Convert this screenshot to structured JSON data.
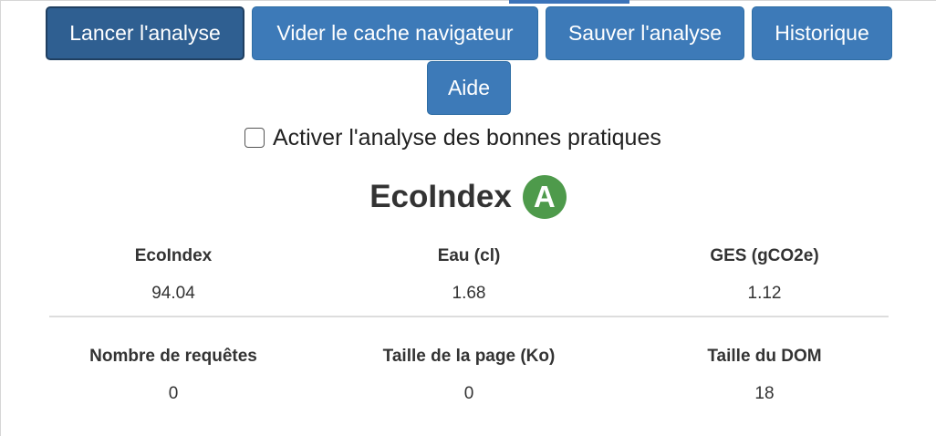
{
  "toolbar": {
    "run_label": "Lancer l'analyse",
    "clear_cache_label": "Vider le cache navigateur",
    "save_label": "Sauver l'analyse",
    "history_label": "Historique",
    "help_label": "Aide"
  },
  "options": {
    "best_practices_checkbox_label": "Activer l'analyse des bonnes pratiques",
    "best_practices_checked": false
  },
  "ecoindex": {
    "title": "EcoIndex",
    "grade": "A",
    "grade_color": "#4e9a4b"
  },
  "metrics": {
    "row1": [
      {
        "label": "EcoIndex",
        "value": "94.04"
      },
      {
        "label": "Eau (cl)",
        "value": "1.68"
      },
      {
        "label": "GES (gCO2e)",
        "value": "1.12"
      }
    ],
    "row2": [
      {
        "label": "Nombre de requêtes",
        "value": "0"
      },
      {
        "label": "Taille de la page (Ko)",
        "value": "0"
      },
      {
        "label": "Taille du DOM",
        "value": "18"
      }
    ]
  },
  "colors": {
    "button": "#3d7ab8",
    "button_active": "#2f5f91",
    "text": "#333333"
  }
}
